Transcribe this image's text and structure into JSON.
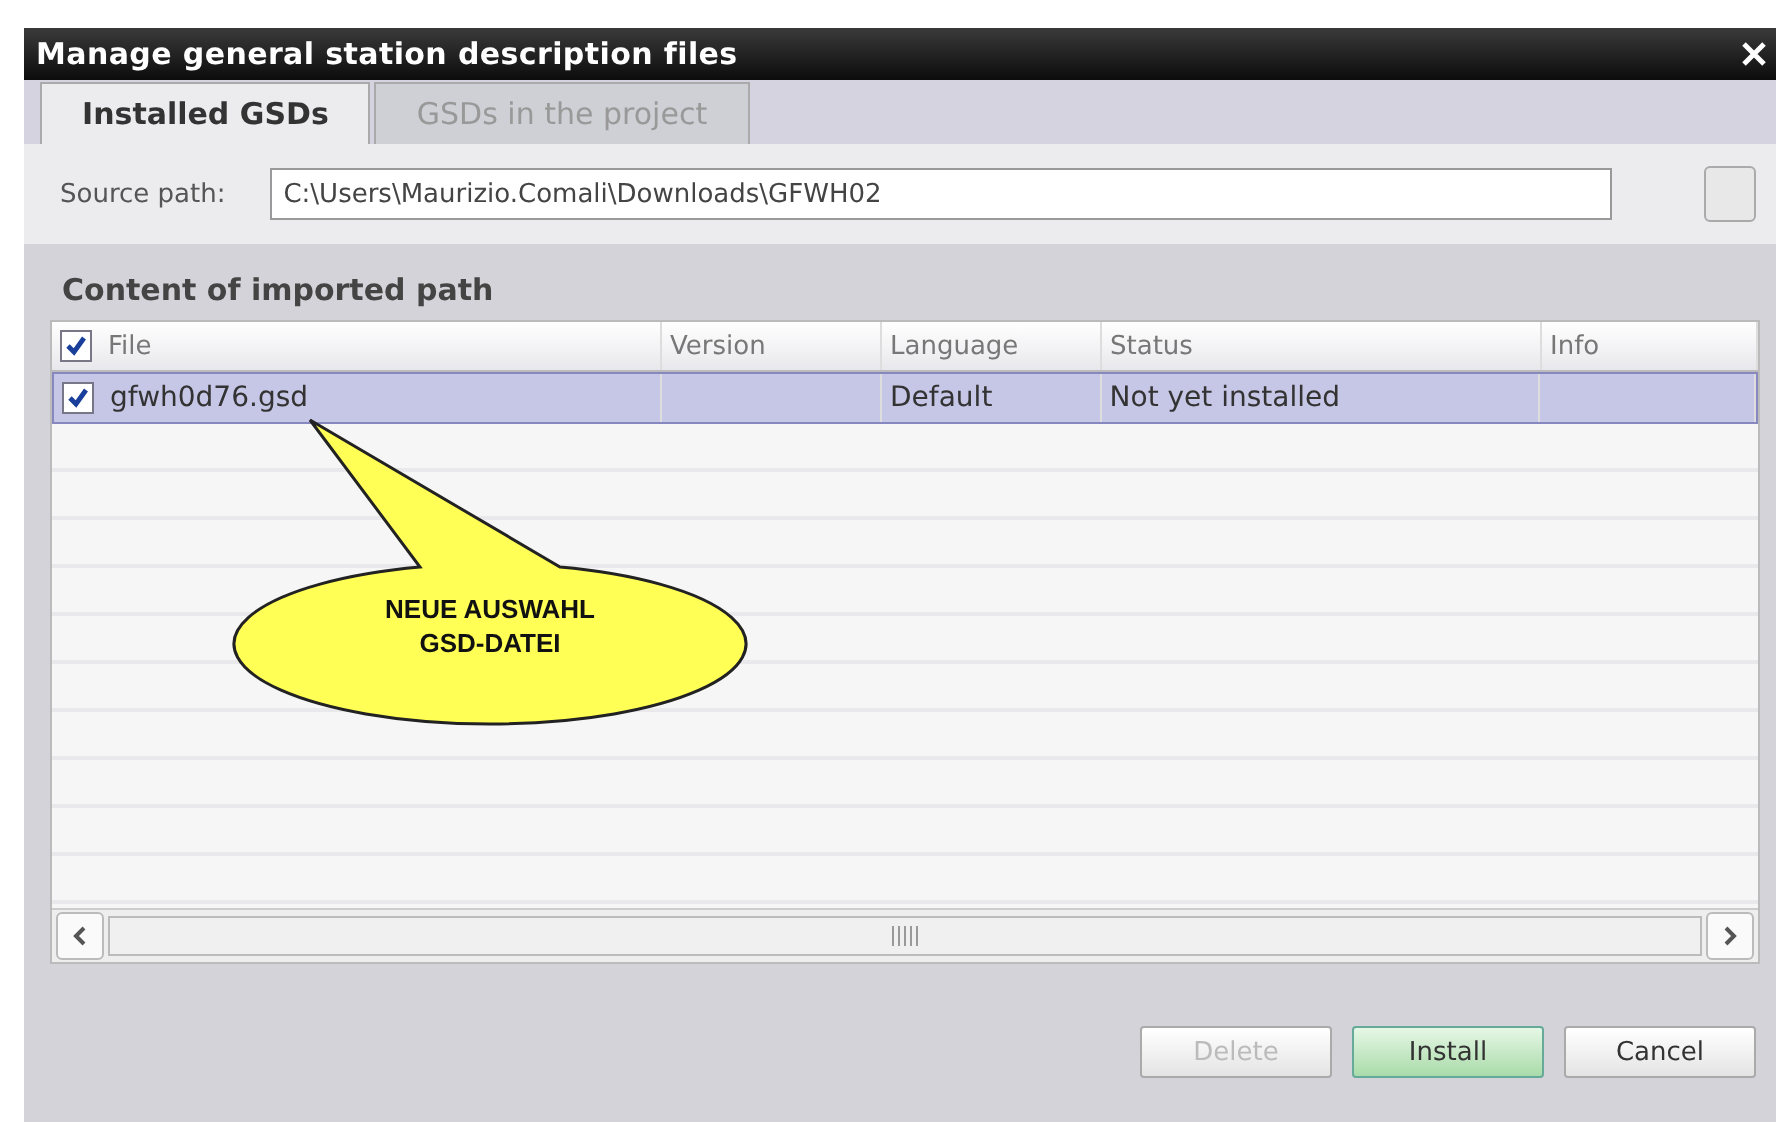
{
  "window": {
    "title": "Manage general station description files"
  },
  "tabs": [
    {
      "label": "Installed GSDs",
      "selected": true
    },
    {
      "label": "GSDs in the project",
      "selected": false
    }
  ],
  "source_path": {
    "label": "Source path:",
    "value": "C:\\Users\\Maurizio.Comali\\Downloads\\GFWH02"
  },
  "section": {
    "title": "Content of imported path"
  },
  "table": {
    "header_checked": true,
    "columns": [
      "File",
      "Version",
      "Language",
      "Status",
      "Info"
    ],
    "rows": [
      {
        "checked": true,
        "selected": true,
        "cells": [
          "gfwh0d76.gsd",
          "",
          "Default",
          "Not yet installed",
          ""
        ]
      }
    ]
  },
  "callout": {
    "lines": [
      "NEUE AUSWAHL",
      "GSD-DATEI"
    ]
  },
  "buttons": [
    {
      "label": "Delete",
      "disabled": true,
      "primary": false
    },
    {
      "label": "Install",
      "disabled": false,
      "primary": true
    },
    {
      "label": "Cancel",
      "disabled": false,
      "primary": false
    }
  ]
}
